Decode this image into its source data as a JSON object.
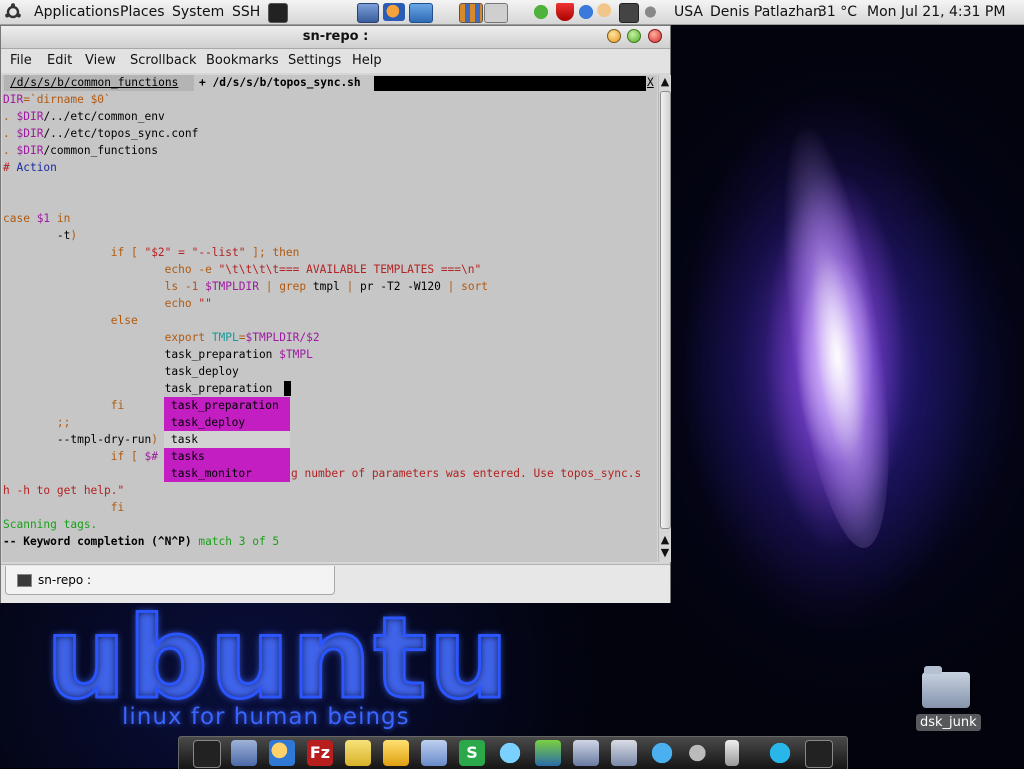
{
  "top_panel": {
    "menus": [
      "Applications",
      "Places",
      "System",
      "SSH"
    ],
    "locale": "USA",
    "user": "Denis Patlazhan",
    "temperature": "31 °C",
    "datetime": "Mon Jul 21,  4:31 PM"
  },
  "window": {
    "title": "sn-repo :",
    "menu": [
      "File",
      "Edit",
      "View",
      "Scrollback",
      "Bookmarks",
      "Settings",
      "Help"
    ],
    "tab_label": "sn-repo :"
  },
  "editor": {
    "buffer_tab_1": "/d/s/s/b/common_functions",
    "buffer_tab_2": "+ /d/s/s/b/topos_sync.sh",
    "buffer_close": "X",
    "lines": {
      "l1_a": "DIR",
      "l1_b": "=`dirname $0`",
      "l2_a": ". ",
      "l2_b": "$DIR",
      "l2_c": "/../etc/common_env",
      "l3_a": ". ",
      "l3_b": "$DIR",
      "l3_c": "/../etc/topos_sync.conf",
      "l4_a": ". ",
      "l4_b": "$DIR",
      "l4_c": "/common_functions",
      "l5_a": "# ",
      "l5_b": "Action",
      "l8_a": "case ",
      "l8_b": "$1",
      "l8_c": " in",
      "l9_a": "        -t",
      "l9_b": ")",
      "l10_a": "                if [ ",
      "l10_b": "\"$2\" = \"--list\"",
      "l10_c": " ]; then",
      "l11_a": "                        echo -e ",
      "l11_b": "\"\\t\\t\\t\\t=== AVAILABLE TEMPLATES ===\\n\"",
      "l12_a": "                        ls -1 ",
      "l12_b": "$TMPLDIR",
      "l12_c": " | ",
      "l12_d": "grep",
      "l12_e": " tmpl ",
      "l12_f": "|",
      "l12_g": " pr -T2 -W120 ",
      "l12_h": "|",
      "l12_i": " sort",
      "l13_a": "                        echo ",
      "l13_b": "\"\"",
      "l14": "                else",
      "l15_a": "                        export ",
      "l15_b": "TMPL",
      "l15_c": "=",
      "l15_d": "$TMPLDIR",
      "l15_e": "/$2",
      "l16_a": "                        task_preparation ",
      "l16_b": "$TMPL",
      "l17": "                        task_deploy",
      "l18": "                        task_preparation",
      "l19": "                fi",
      "l20": "        ;;",
      "l21_a": "        --tmpl-dry-run",
      "l21_b": ")",
      "l22_a": "                if [ ",
      "l22_b": "$#",
      "l23_tail": "g number of parameters was entered. Use topos_sync.s",
      "l24": "h -h to get help.\"",
      "l25": "                fi",
      "status_scan": "Scanning tags.",
      "status_mode": "-- Keyword completion (^N^P) ",
      "status_match": "match 3 of 5"
    },
    "completion_popup": [
      "task_preparation",
      "task_deploy",
      "task",
      "tasks",
      "task_monitor"
    ],
    "completion_selected_index": 2
  },
  "desktop": {
    "wordmark": "ubuntu",
    "tagline": "linux for human beings",
    "folder_label": "dsk_junk"
  },
  "colors": {
    "popup_bg": "#c21ec2",
    "popup_selected_bg": "#d2d2d2",
    "terminal_bg": "#c6c6c6"
  }
}
